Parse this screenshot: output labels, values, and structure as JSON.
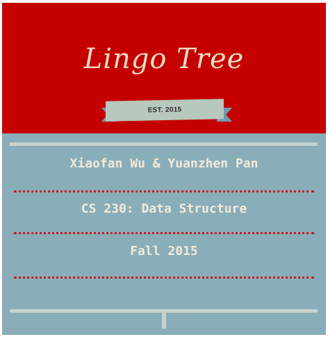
{
  "header": {
    "logo": "Lingo Tree",
    "badge": "EST. 2015"
  },
  "lines": [
    "Xiaofan Wu & Yuanzhen Pan",
    "CS 230: Data Structure",
    "Fall 2015"
  ],
  "colors": {
    "header_bg": "#c50000",
    "body_bg": "#8aadba",
    "logo_text": "#efdcc4",
    "ribbon": "#b7c8bd",
    "ribbon_tail": "#6d9bb0",
    "divider": "#c81a1a",
    "rail": "#c6d2cc"
  }
}
